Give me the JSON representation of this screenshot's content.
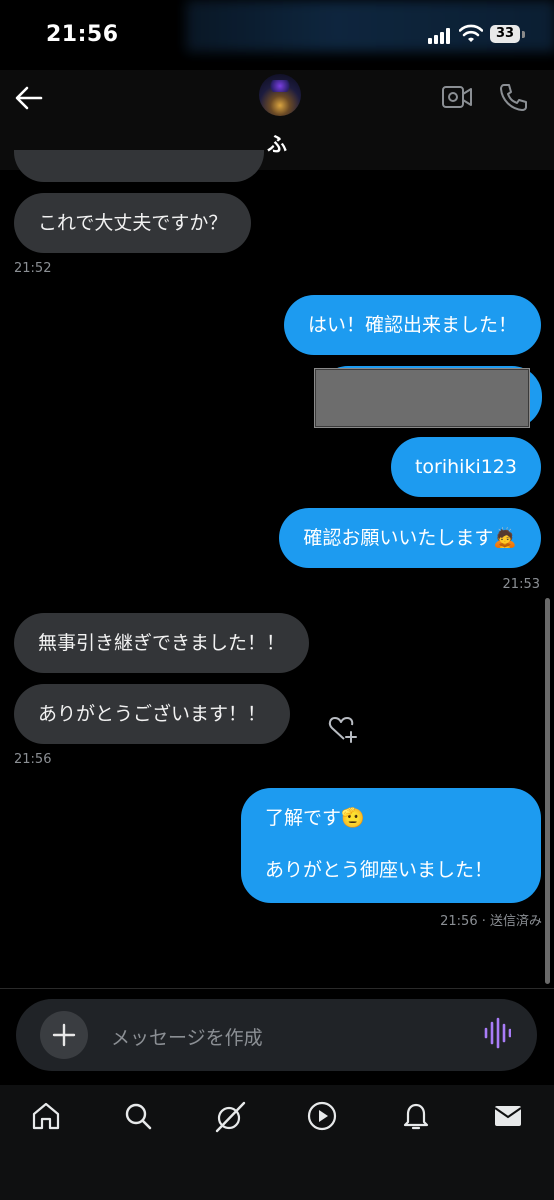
{
  "status_bar": {
    "time": "21:56",
    "battery": "33"
  },
  "header": {
    "contact_name": "ふ"
  },
  "messages": [
    {
      "text": "これで大丈夫ですか？"
    },
    {
      "text": "はい！確認出来ました！"
    },
    {
      "text": "torihiki123"
    },
    {
      "text": "確認お願いいたします🙇"
    },
    {
      "text": "無事引き継ぎできました！！"
    },
    {
      "text": "ありがとうございます！！"
    },
    {
      "line1": "了解です🫡",
      "line2": "ありがとう御座いました！"
    }
  ],
  "timestamps": {
    "t1": "21:52",
    "t2": "21:53",
    "t3": "21:56",
    "t4": "21:56 · 送信済み"
  },
  "composer": {
    "placeholder": "メッセージを作成"
  },
  "colors": {
    "accent": "#1d9bf0",
    "incoming_bubble": "#333538",
    "voice_icon": "#a97cf8"
  },
  "tabs": [
    "home-icon",
    "search-icon",
    "grok-icon",
    "video-icon",
    "notifications-icon",
    "messages-icon"
  ]
}
